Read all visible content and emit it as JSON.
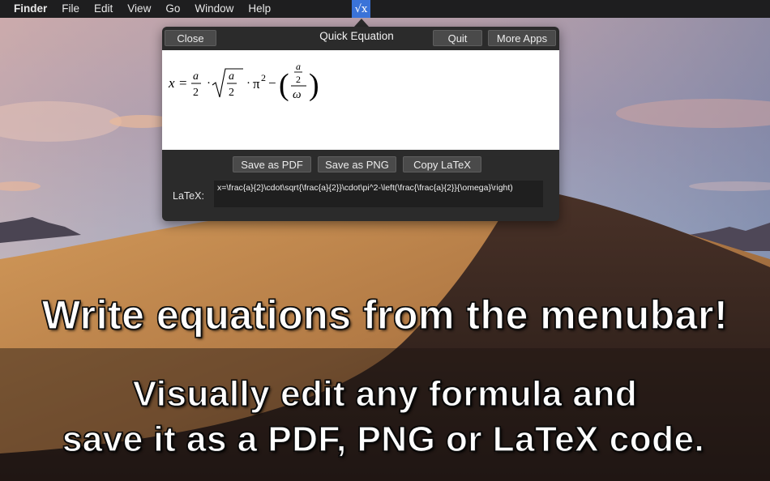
{
  "menubar": {
    "app_name": "Finder",
    "items": [
      "File",
      "Edit",
      "View",
      "Go",
      "Window",
      "Help"
    ],
    "status_icon": "square-root-x-icon",
    "status_icon_glyph": "√x",
    "status_icon_color": "#3a73d8"
  },
  "popover": {
    "title": "Quick Equation",
    "close_label": "Close",
    "quit_label": "Quit",
    "more_apps_label": "More Apps",
    "equation_display": {
      "lhs": "x",
      "equals": "=",
      "frac1_num": "a",
      "frac1_den": "2",
      "dot": "·",
      "sqrt_num": "a",
      "sqrt_den": "2",
      "pi": "π",
      "pi_exp": "2",
      "minus": "−",
      "inner_num": "a",
      "inner_den": "2",
      "outer_den": "ω",
      "lparen": "(",
      "rparen": ")"
    },
    "save_pdf_label": "Save as PDF",
    "save_png_label": "Save as PNG",
    "copy_latex_label": "Copy LaTeX",
    "latex_label": "LaTeX:",
    "latex_value": "x=\\frac{a}{2}\\cdot\\sqrt{\\frac{a}{2}}\\cdot\\pi^2-\\left(\\frac{\\frac{a}{2}}{\\omega}\\right)"
  },
  "marketing": {
    "headline": "Write equations from the menubar!",
    "subline_1": "Visually edit any formula and",
    "subline_2": "save it as a PDF, PNG or LaTeX code."
  }
}
